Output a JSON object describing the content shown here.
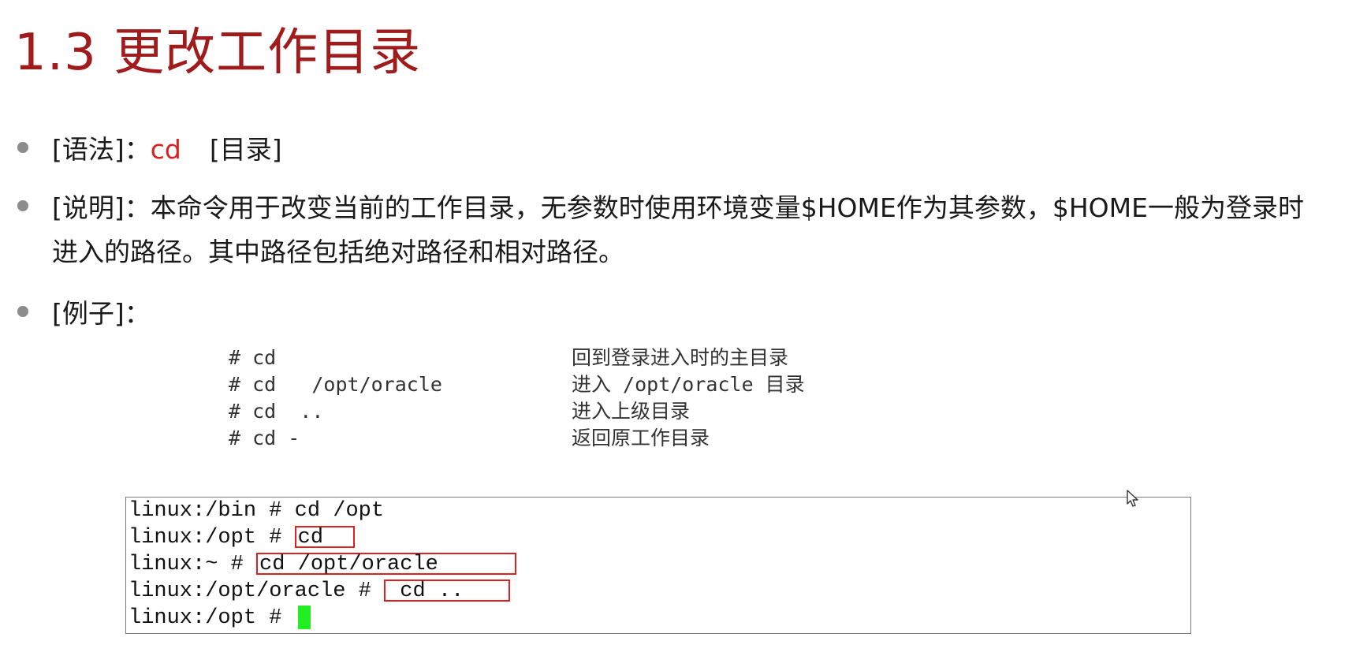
{
  "title": "1.3 更改工作目录",
  "bullets": {
    "syntax": {
      "label": "[语法]：",
      "command": "cd",
      "arg": "[目录]"
    },
    "description": {
      "label": "[说明]：",
      "text": "本命令用于改变当前的工作目录，无参数时使用环境变量$HOME作为其参数，$HOME一般为登录时进入的路径。其中路径包括绝对路径和相对路径。"
    },
    "example": {
      "label": "[例子]："
    }
  },
  "examples": [
    {
      "cmd": "# cd",
      "desc": "回到登录进入时的主目录"
    },
    {
      "cmd": "# cd   /opt/oracle",
      "desc": "进入 /opt/oracle 目录"
    },
    {
      "cmd": "# cd  ..",
      "desc": "进入上级目录"
    },
    {
      "cmd": "# cd -",
      "desc": "返回原工作目录"
    }
  ],
  "terminal": {
    "lines": [
      {
        "prompt": "linux:/bin # ",
        "cmd": "cd /opt"
      },
      {
        "prompt": "linux:/opt # ",
        "cmd": "cd"
      },
      {
        "prompt": "linux:~ # ",
        "cmd": "cd /opt/oracle"
      },
      {
        "prompt": "linux:/opt/oracle # ",
        "cmd": " cd .."
      },
      {
        "prompt": "linux:/opt # ",
        "cmd": ""
      }
    ]
  },
  "colors": {
    "title": "#a01c1c",
    "highlight": "#e02020",
    "cursor": "#22ee22"
  },
  "icons": {
    "pointer": "mouse-pointer-icon"
  }
}
